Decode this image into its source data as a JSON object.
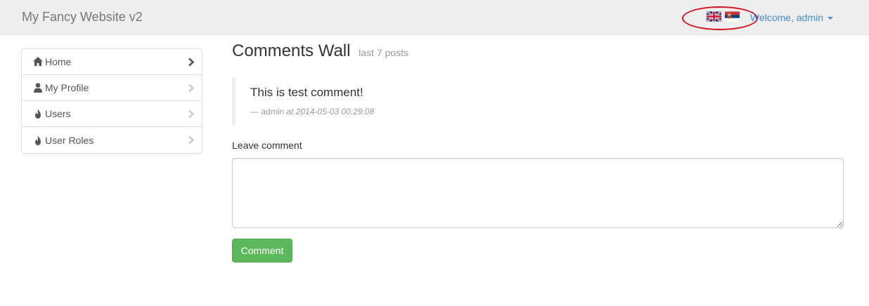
{
  "navbar": {
    "brand": "My Fancy Website v2",
    "welcome": "Welcome, admin",
    "languages": [
      {
        "name": "English",
        "icon": "uk-flag-icon"
      },
      {
        "name": "Serbian",
        "icon": "serbia-flag-icon"
      }
    ]
  },
  "sidebar": {
    "items": [
      {
        "label": "Home",
        "icon": "home-icon"
      },
      {
        "label": "My Profile",
        "icon": "user-icon"
      },
      {
        "label": "Users",
        "icon": "fire-icon"
      },
      {
        "label": "User Roles",
        "icon": "fire-icon"
      }
    ]
  },
  "main": {
    "title": "Comments Wall",
    "subtitle": "last 7 posts",
    "comments": [
      {
        "text": "This is test comment!",
        "dash": "—",
        "author": "admin",
        "meta": "at 2014-05-03 00:29:08"
      }
    ],
    "form": {
      "label": "Leave comment",
      "value": "",
      "submit": "Comment"
    }
  },
  "colors": {
    "navbar_bg": "#eeeeee",
    "link": "#428bca",
    "button": "#5cb85c",
    "annotation": "#d6101e"
  }
}
